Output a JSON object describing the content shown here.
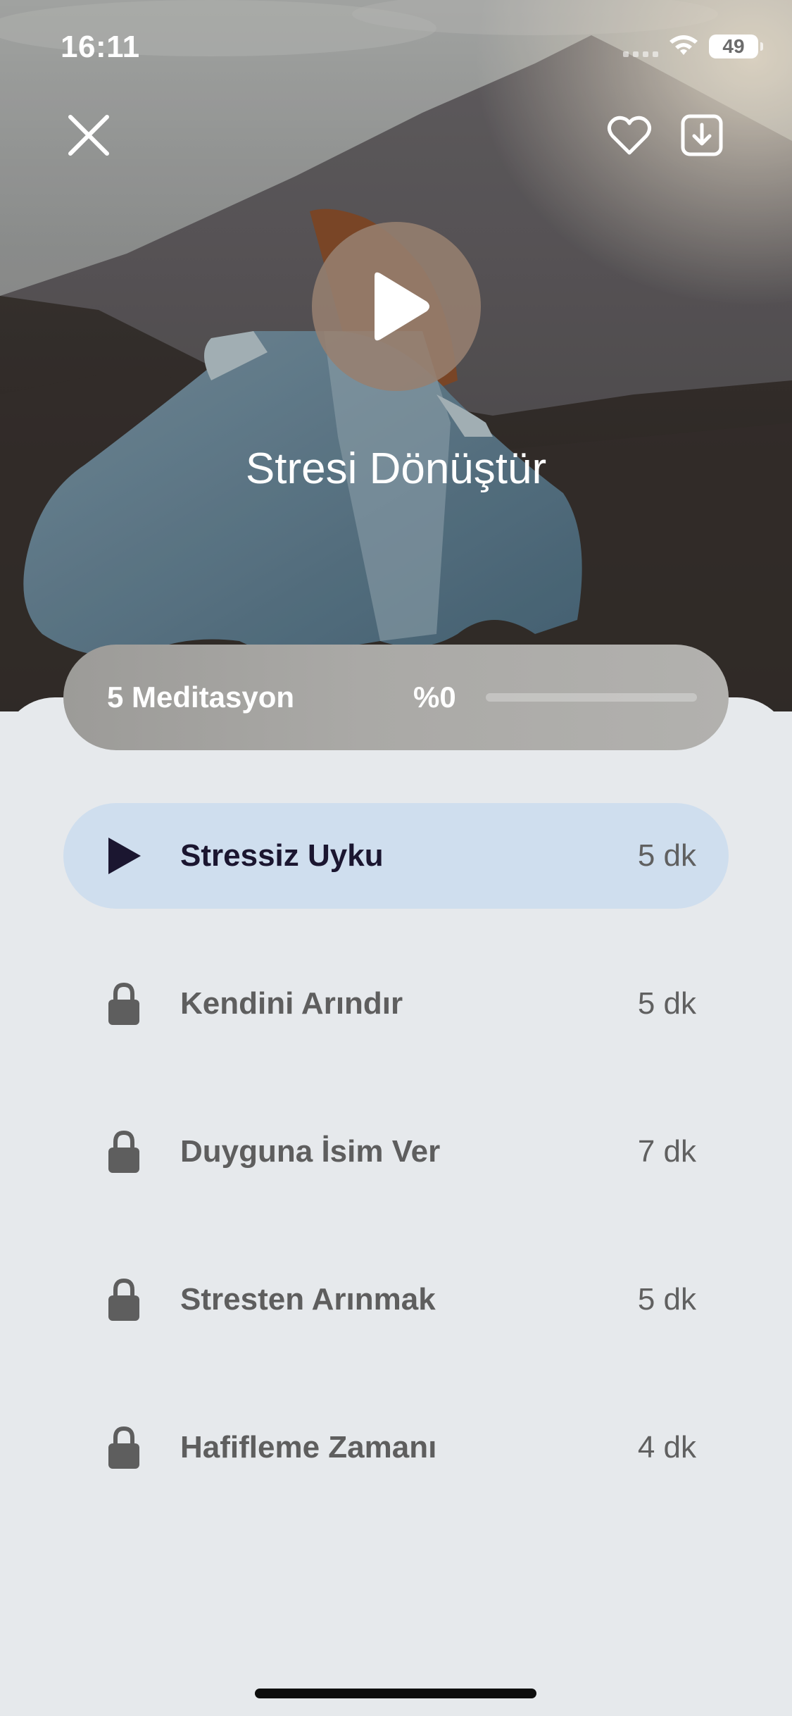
{
  "status_bar": {
    "time": "16:11",
    "battery": "49"
  },
  "header": {
    "close_icon": "close-icon",
    "favorite_icon": "heart-icon",
    "download_icon": "download-icon"
  },
  "player": {
    "title": "Stresi Dönüştür",
    "play_icon": "play-icon"
  },
  "progress": {
    "count_label": "5 Meditasyon",
    "percent_label": "%0",
    "value": 0
  },
  "tracks": [
    {
      "name": "Stressiz Uyku",
      "duration": "5 dk",
      "state": "playable",
      "icon": "play-icon"
    },
    {
      "name": "Kendini Arındır",
      "duration": "5 dk",
      "state": "locked",
      "icon": "lock-icon"
    },
    {
      "name": "Duyguna İsim Ver",
      "duration": "7 dk",
      "state": "locked",
      "icon": "lock-icon"
    },
    {
      "name": "Stresten Arınmak",
      "duration": "5 dk",
      "state": "locked",
      "icon": "lock-icon"
    },
    {
      "name": "Hafifleme Zamanı",
      "duration": "4 dk",
      "state": "locked",
      "icon": "lock-icon"
    }
  ],
  "colors": {
    "active_row": "#cfdeee",
    "sheet": "#e6e9ec",
    "active_play": "#1b1630",
    "lock": "#5e5e5e"
  }
}
